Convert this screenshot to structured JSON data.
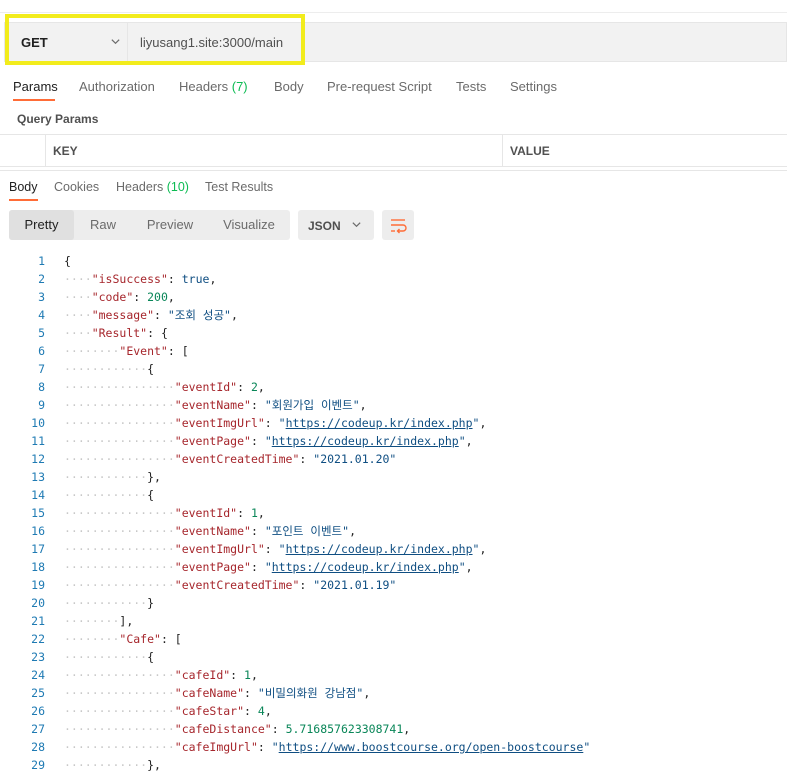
{
  "request": {
    "method": "GET",
    "url": "liyusang1.site:3000/main"
  },
  "request_tabs": [
    {
      "label": "Params",
      "count": ""
    },
    {
      "label": "Authorization",
      "count": ""
    },
    {
      "label": "Headers",
      "count": "(7)"
    },
    {
      "label": "Body",
      "count": ""
    },
    {
      "label": "Pre-request Script",
      "count": ""
    },
    {
      "label": "Tests",
      "count": ""
    },
    {
      "label": "Settings",
      "count": ""
    }
  ],
  "query_params": {
    "title": "Query Params",
    "col_key": "KEY",
    "col_value": "VALUE"
  },
  "response_tabs": [
    {
      "label": "Body",
      "count": ""
    },
    {
      "label": "Cookies",
      "count": ""
    },
    {
      "label": "Headers",
      "count": "(10)"
    },
    {
      "label": "Test Results",
      "count": ""
    }
  ],
  "view_modes": [
    "Pretty",
    "Raw",
    "Preview",
    "Visualize"
  ],
  "format": "JSON",
  "icons": {
    "method_dropdown": "chevron-down-icon",
    "format_dropdown": "chevron-down-icon",
    "wrap": "wrap-lines-icon"
  },
  "colors": {
    "accent": "#ff6c37",
    "highlight_box": "#f2ec1c",
    "count_green": "#0cbb52"
  },
  "code_lines": [
    {
      "n": "1",
      "indent": 0,
      "tokens": [
        [
          "p",
          "{"
        ]
      ]
    },
    {
      "n": "2",
      "indent": 1,
      "tokens": [
        [
          "k",
          "\"isSuccess\""
        ],
        [
          "p",
          ": "
        ],
        [
          "b",
          "true"
        ],
        [
          "p",
          ","
        ]
      ]
    },
    {
      "n": "3",
      "indent": 1,
      "tokens": [
        [
          "k",
          "\"code\""
        ],
        [
          "p",
          ": "
        ],
        [
          "n",
          "200"
        ],
        [
          "p",
          ","
        ]
      ]
    },
    {
      "n": "4",
      "indent": 1,
      "tokens": [
        [
          "k",
          "\"message\""
        ],
        [
          "p",
          ": "
        ],
        [
          "s",
          "\"조회 성공\""
        ],
        [
          "p",
          ","
        ]
      ]
    },
    {
      "n": "5",
      "indent": 1,
      "tokens": [
        [
          "k",
          "\"Result\""
        ],
        [
          "p",
          ": {"
        ]
      ]
    },
    {
      "n": "6",
      "indent": 2,
      "tokens": [
        [
          "k",
          "\"Event\""
        ],
        [
          "p",
          ": ["
        ]
      ]
    },
    {
      "n": "7",
      "indent": 3,
      "tokens": [
        [
          "p",
          "{"
        ]
      ]
    },
    {
      "n": "8",
      "indent": 4,
      "tokens": [
        [
          "k",
          "\"eventId\""
        ],
        [
          "p",
          ": "
        ],
        [
          "n",
          "2"
        ],
        [
          "p",
          ","
        ]
      ]
    },
    {
      "n": "9",
      "indent": 4,
      "tokens": [
        [
          "k",
          "\"eventName\""
        ],
        [
          "p",
          ": "
        ],
        [
          "s",
          "\"회원가입 이벤트\""
        ],
        [
          "p",
          ","
        ]
      ]
    },
    {
      "n": "10",
      "indent": 4,
      "tokens": [
        [
          "k",
          "\"eventImgUrl\""
        ],
        [
          "p",
          ": "
        ],
        [
          "s",
          "\""
        ],
        [
          "u",
          "https://codeup.kr/index.php"
        ],
        [
          "s",
          "\""
        ],
        [
          "p",
          ","
        ]
      ]
    },
    {
      "n": "11",
      "indent": 4,
      "tokens": [
        [
          "k",
          "\"eventPage\""
        ],
        [
          "p",
          ": "
        ],
        [
          "s",
          "\""
        ],
        [
          "u",
          "https://codeup.kr/index.php"
        ],
        [
          "s",
          "\""
        ],
        [
          "p",
          ","
        ]
      ]
    },
    {
      "n": "12",
      "indent": 4,
      "tokens": [
        [
          "k",
          "\"eventCreatedTime\""
        ],
        [
          "p",
          ": "
        ],
        [
          "s",
          "\"2021.01.20\""
        ]
      ]
    },
    {
      "n": "13",
      "indent": 3,
      "tokens": [
        [
          "p",
          "},"
        ]
      ]
    },
    {
      "n": "14",
      "indent": 3,
      "tokens": [
        [
          "p",
          "{"
        ]
      ]
    },
    {
      "n": "15",
      "indent": 4,
      "tokens": [
        [
          "k",
          "\"eventId\""
        ],
        [
          "p",
          ": "
        ],
        [
          "n",
          "1"
        ],
        [
          "p",
          ","
        ]
      ]
    },
    {
      "n": "16",
      "indent": 4,
      "tokens": [
        [
          "k",
          "\"eventName\""
        ],
        [
          "p",
          ": "
        ],
        [
          "s",
          "\"포인트 이벤트\""
        ],
        [
          "p",
          ","
        ]
      ]
    },
    {
      "n": "17",
      "indent": 4,
      "tokens": [
        [
          "k",
          "\"eventImgUrl\""
        ],
        [
          "p",
          ": "
        ],
        [
          "s",
          "\""
        ],
        [
          "u",
          "https://codeup.kr/index.php"
        ],
        [
          "s",
          "\""
        ],
        [
          "p",
          ","
        ]
      ]
    },
    {
      "n": "18",
      "indent": 4,
      "tokens": [
        [
          "k",
          "\"eventPage\""
        ],
        [
          "p",
          ": "
        ],
        [
          "s",
          "\""
        ],
        [
          "u",
          "https://codeup.kr/index.php"
        ],
        [
          "s",
          "\""
        ],
        [
          "p",
          ","
        ]
      ]
    },
    {
      "n": "19",
      "indent": 4,
      "tokens": [
        [
          "k",
          "\"eventCreatedTime\""
        ],
        [
          "p",
          ": "
        ],
        [
          "s",
          "\"2021.01.19\""
        ]
      ]
    },
    {
      "n": "20",
      "indent": 3,
      "tokens": [
        [
          "p",
          "}"
        ]
      ]
    },
    {
      "n": "21",
      "indent": 2,
      "tokens": [
        [
          "p",
          "],"
        ]
      ]
    },
    {
      "n": "22",
      "indent": 2,
      "tokens": [
        [
          "k",
          "\"Cafe\""
        ],
        [
          "p",
          ": ["
        ]
      ]
    },
    {
      "n": "23",
      "indent": 3,
      "tokens": [
        [
          "p",
          "{"
        ]
      ]
    },
    {
      "n": "24",
      "indent": 4,
      "tokens": [
        [
          "k",
          "\"cafeId\""
        ],
        [
          "p",
          ": "
        ],
        [
          "n",
          "1"
        ],
        [
          "p",
          ","
        ]
      ]
    },
    {
      "n": "25",
      "indent": 4,
      "tokens": [
        [
          "k",
          "\"cafeName\""
        ],
        [
          "p",
          ": "
        ],
        [
          "s",
          "\"비밀의화원 강남점\""
        ],
        [
          "p",
          ","
        ]
      ]
    },
    {
      "n": "26",
      "indent": 4,
      "tokens": [
        [
          "k",
          "\"cafeStar\""
        ],
        [
          "p",
          ": "
        ],
        [
          "n",
          "4"
        ],
        [
          "p",
          ","
        ]
      ]
    },
    {
      "n": "27",
      "indent": 4,
      "tokens": [
        [
          "k",
          "\"cafeDistance\""
        ],
        [
          "p",
          ": "
        ],
        [
          "n",
          "5.716857623308741"
        ],
        [
          "p",
          ","
        ]
      ]
    },
    {
      "n": "28",
      "indent": 4,
      "tokens": [
        [
          "k",
          "\"cafeImgUrl\""
        ],
        [
          "p",
          ": "
        ],
        [
          "s",
          "\""
        ],
        [
          "u",
          "https://www.boostcourse.org/open-boostcourse"
        ],
        [
          "s",
          "\""
        ]
      ]
    },
    {
      "n": "29",
      "indent": 3,
      "tokens": [
        [
          "p",
          "},"
        ]
      ]
    }
  ]
}
